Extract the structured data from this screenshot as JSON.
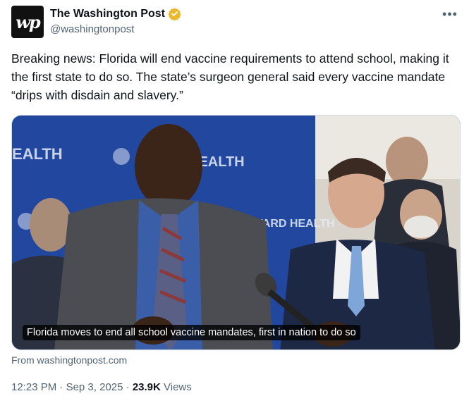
{
  "author": {
    "display_name": "The Washington Post",
    "handle": "@washingtonpost",
    "avatar_text": "wp",
    "verified_color": "#e8b82e"
  },
  "tweet": {
    "text": "Breaking news: Florida will end vaccine requirements to attend school, making it the first state to do so. The state’s surgeon general said every vaccine mandate “drips with disdain and slavery.”"
  },
  "media": {
    "caption": "Florida moves to end all school vaccine mandates, first in nation to do so",
    "backdrop_text_1": "EALTH",
    "backdrop_text_2": "HEALTH",
    "backdrop_text_3": "BROWARD HEALTH",
    "source": "From washingtonpost.com"
  },
  "meta": {
    "time": "12:23 PM",
    "sep1": "·",
    "date": "Sep 3, 2025",
    "sep2": "·",
    "views_count": "23.9K",
    "views_label": "Views"
  },
  "more_icon": "ellipsis-icon"
}
